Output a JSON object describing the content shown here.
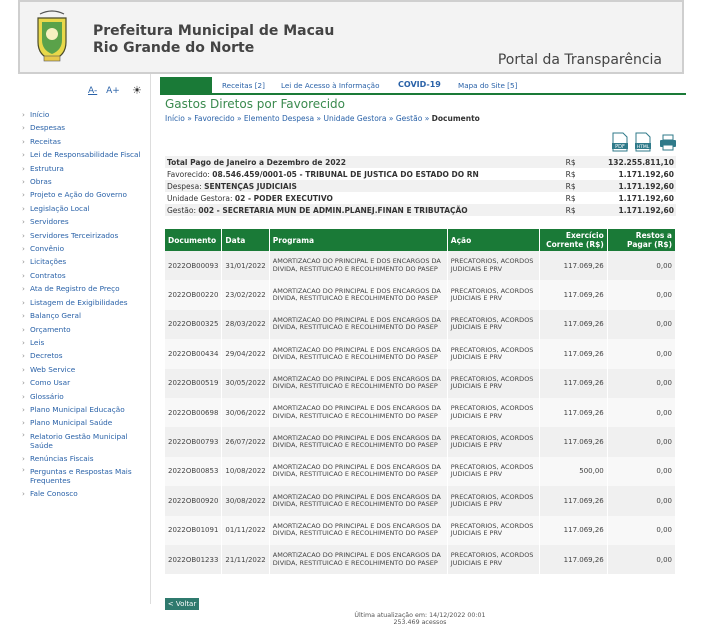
{
  "header": {
    "line1": "Prefeitura Municipal de Macau",
    "line2": "Rio Grande do Norte",
    "portal": "Portal da Transparência",
    "logo_icon": "city-coat-of-arms-icon"
  },
  "accessibility": {
    "decrease": "A-",
    "increase": "A+",
    "contrast_icon": "contrast-icon"
  },
  "sidebar": {
    "items": [
      "Início",
      "Despesas",
      "Receitas",
      "Lei de Responsabilidade Fiscal",
      "Estrutura",
      "Obras",
      "Projeto e Ação do Governo",
      "Legislação Local",
      "Servidores",
      "Servidores Terceirizados",
      "Convênio",
      "Licitações",
      "Contratos",
      "Ata de Registro de Preço",
      "Listagem de Exigibilidades",
      "Balanço Geral",
      "Orçamento",
      "Leis",
      "Decretos",
      "Web Service",
      "Como Usar",
      "Glossário",
      "Plano Municipal Educação",
      "Plano Municipal Saúde",
      "Relatorio Gestão Municipal Saúde",
      "Renúncias Fiscais",
      "Perguntas e Respostas Mais Frequentes",
      "Fale Conosco"
    ]
  },
  "topnav": {
    "items": [
      "Receitas [2]",
      "Lei de Acesso à Informação",
      "COVID-19",
      "Mapa do Site [5]"
    ]
  },
  "page": {
    "title": "Gastos Diretos por Favorecido",
    "breadcrumb": [
      "Início",
      "Favorecido",
      "Elemento Despesa",
      "Unidade Gestora",
      "Gestão"
    ],
    "breadcrumb_current": "Documento",
    "export": {
      "pdf": "PDF",
      "html": "HTML",
      "print_icon": "printer-icon"
    }
  },
  "summary": [
    {
      "label": "Total Pago de Janeiro a Dezembro de 2022",
      "value": "",
      "currency": "R$",
      "amount": "132.255.811,10",
      "bold_label": true
    },
    {
      "label": "Favorecido:",
      "value": "08.546.459/0001-05 - TRIBUNAL DE JUSTICA DO ESTADO DO RN",
      "currency": "R$",
      "amount": "1.171.192,60"
    },
    {
      "label": "Despesa:",
      "value": "SENTENÇAS JUDICIAIS",
      "currency": "R$",
      "amount": "1.171.192,60"
    },
    {
      "label": "Unidade Gestora:",
      "value": "02 - PODER EXECUTIVO",
      "currency": "R$",
      "amount": "1.171.192,60"
    },
    {
      "label": "Gestão:",
      "value": "002 - SECRETARIA MUN DE ADMIN.PLANEJ.FINAN E TRIBUTAÇÃO",
      "currency": "R$",
      "amount": "1.171.192,60"
    }
  ],
  "table": {
    "headers": [
      "Documento",
      "Data",
      "Programa",
      "Ação",
      "Exercício Corrente (R$)",
      "Restos a Pagar (R$)"
    ],
    "program": "AMORTIZACAO DO PRINCIPAL E DOS ENCARGOS DA DIVIDA, RESTITUICAO E RECOLHIMENTO DO PASEP",
    "action": "PRECATORIOS, ACORDOS JUDICIAIS E PRV",
    "rows": [
      {
        "doc": "2022OB00093",
        "date": "31/01/2022",
        "current": "117.069,26",
        "restos": "0,00"
      },
      {
        "doc": "2022OB00220",
        "date": "23/02/2022",
        "current": "117.069,26",
        "restos": "0,00"
      },
      {
        "doc": "2022OB00325",
        "date": "28/03/2022",
        "current": "117.069,26",
        "restos": "0,00"
      },
      {
        "doc": "2022OB00434",
        "date": "29/04/2022",
        "current": "117.069,26",
        "restos": "0,00"
      },
      {
        "doc": "2022OB00519",
        "date": "30/05/2022",
        "current": "117.069,26",
        "restos": "0,00"
      },
      {
        "doc": "2022OB00698",
        "date": "30/06/2022",
        "current": "117.069,26",
        "restos": "0,00"
      },
      {
        "doc": "2022OB00793",
        "date": "26/07/2022",
        "current": "117.069,26",
        "restos": "0,00"
      },
      {
        "doc": "2022OB00853",
        "date": "10/08/2022",
        "current": "500,00",
        "restos": "0,00"
      },
      {
        "doc": "2022OB00920",
        "date": "30/08/2022",
        "current": "117.069,26",
        "restos": "0,00"
      },
      {
        "doc": "2022OB01091",
        "date": "01/11/2022",
        "current": "117.069,26",
        "restos": "0,00"
      },
      {
        "doc": "2022OB01233",
        "date": "21/11/2022",
        "current": "117.069,26",
        "restos": "0,00"
      }
    ]
  },
  "back": "< Voltar",
  "footer": {
    "updated": "Última atualização em: 14/12/2022 00:01",
    "visits": "253.469 acessos"
  },
  "colors": {
    "green": "#1a7a37",
    "link": "#2a62a8"
  }
}
